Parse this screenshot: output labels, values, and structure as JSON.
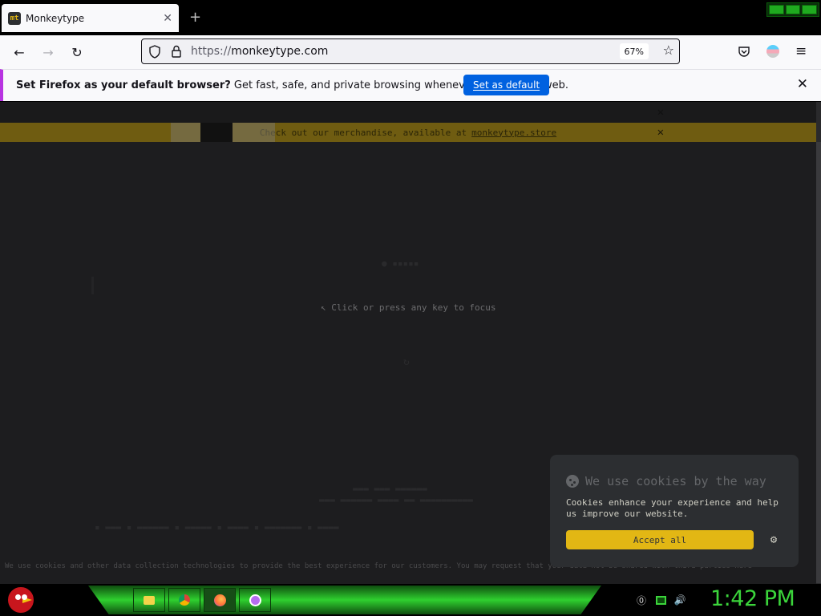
{
  "browser": {
    "tab": {
      "favicon_text": "mt",
      "title": "Monkeytype",
      "close": "✕"
    },
    "new_tab": "+",
    "nav": {
      "back": "←",
      "forward": "→",
      "reload": "↻"
    },
    "url": {
      "scheme": "https://",
      "host": "monkeytype.com",
      "zoom": "67%"
    },
    "toolbar_icons": [
      "shield-icon",
      "lock-icon",
      "star-icon",
      "pocket-icon",
      "account-icon",
      "menu-icon"
    ]
  },
  "notification": {
    "bold": "Set Firefox as your default browser?",
    "text": " Get fast, safe, and private browsing whenever you use the web.",
    "button": "Set as default",
    "close": "✕"
  },
  "page": {
    "banner_merch_text": "Check out our merchandise, available at",
    "banner_merch_link": "monkeytype.store",
    "banner_close": "✕",
    "focus_hint": "Click or press any key to focus",
    "legal_text": "We use cookies and other data collection technologies to provide the best experience for our customers. You may request that your data not be shared with third parties here"
  },
  "cookie_popup": {
    "title": "We use cookies by the way",
    "body": "Cookies enhance your experience and help us improve our website.",
    "accept": "Accept all",
    "settings_icon": "gear-icon"
  },
  "taskbar": {
    "apps": [
      "files-icon",
      "chrome-icon",
      "firefox-icon",
      "app-icon"
    ],
    "clock": "1:42 PM"
  },
  "colors": {
    "accent": "#e2b714",
    "firefox_blue": "#0061e0",
    "clock_green": "#3bd43b"
  }
}
